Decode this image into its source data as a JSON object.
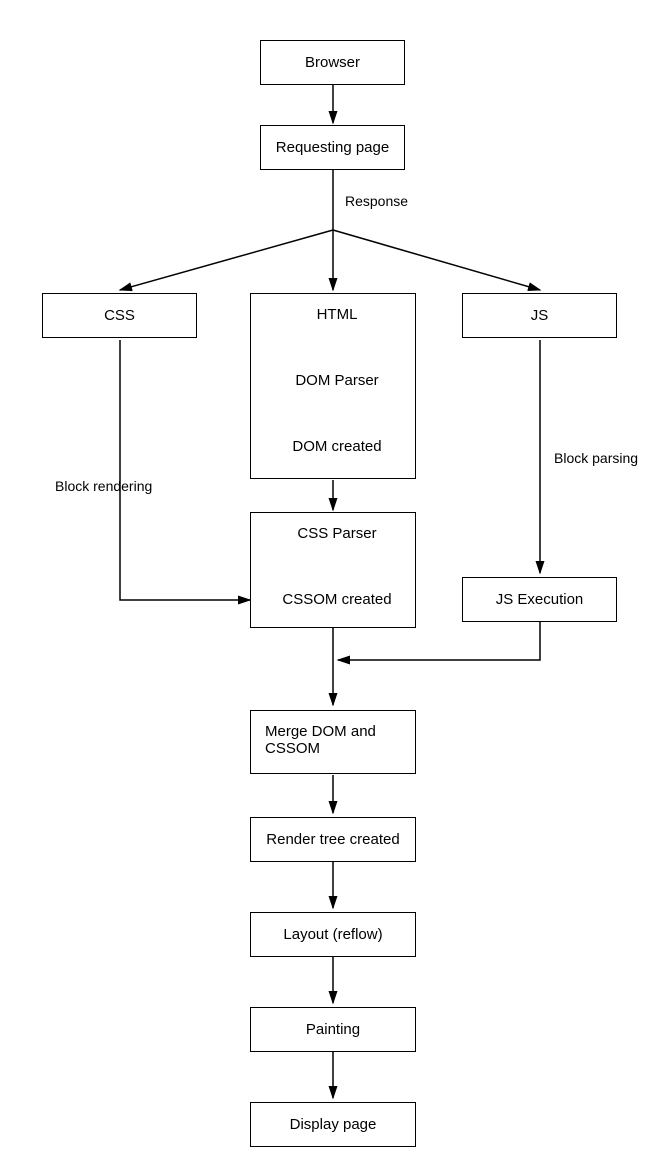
{
  "nodes": {
    "browser": "Browser",
    "requesting": "Requesting page",
    "css": "CSS",
    "html": "HTML",
    "dom_parser": "DOM Parser",
    "dom_created": "DOM created",
    "css_parser": "CSS Parser",
    "cssom_created": "CSSOM created",
    "js": "JS",
    "js_exec": "JS Execution",
    "merge": "Merge DOM and CSSOM",
    "render_tree": "Render tree created",
    "layout": "Layout (reflow)",
    "painting": "Painting",
    "display": "Display page"
  },
  "edges": {
    "response": "Response",
    "block_rendering": "Block rendering",
    "block_parsing": "Block parsing"
  }
}
